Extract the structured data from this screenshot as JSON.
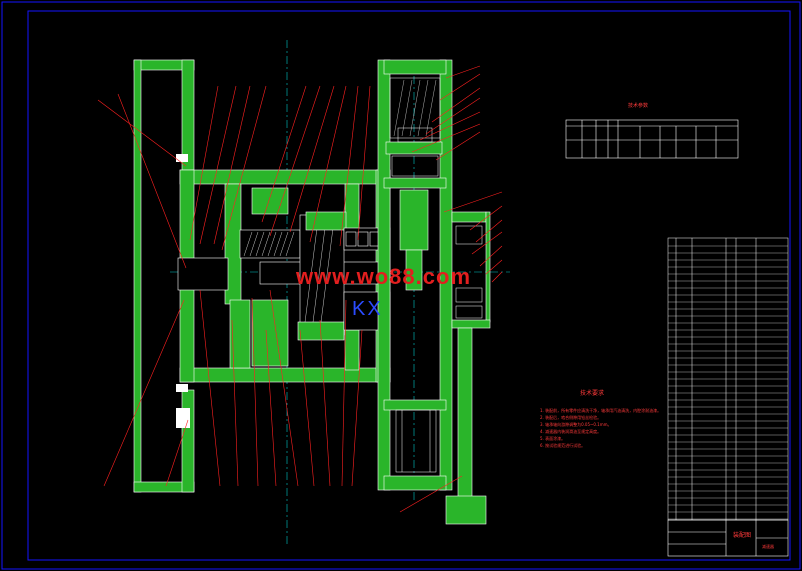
{
  "drawing": {
    "watermark": "www.wo88.com",
    "center_mark": "KX",
    "notes_title": "技术要求",
    "notes": [
      "1. 装配前，所有零件应清洗干净，轴承用汽油清洗，内腔涂耐油漆。",
      "2. 装配后，啮合侧隙用铅丝检验。",
      "3. 轴承轴向游隙调整为0.05~0.1mm。",
      "4. 减速器内装润滑油至规定高度。",
      "5. 表面涂漆。",
      "6. 按试验规范进行试验。"
    ],
    "param_table_title": "技术参数",
    "title_block_main": "装配图",
    "title_block_sub": "减速器"
  },
  "colors": {
    "frame": "#1515ff",
    "body_fill": "#2ab52a",
    "leader": "#ff2020",
    "hatch": "#ffffff",
    "centerline": "#00ffff"
  }
}
